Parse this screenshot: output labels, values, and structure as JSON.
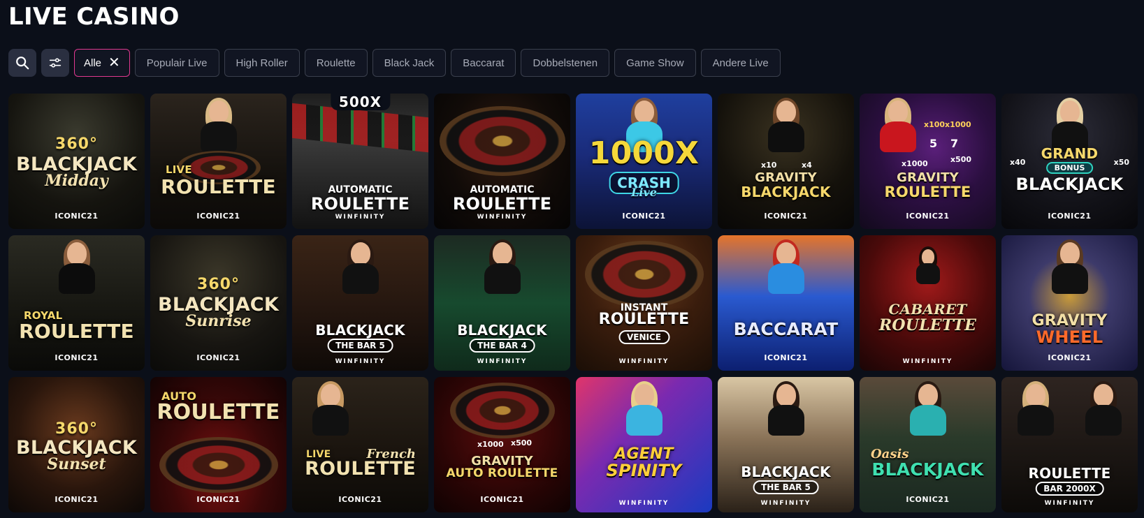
{
  "page": {
    "title": "LIVE CASINO"
  },
  "filters": {
    "search_icon": "search-icon",
    "filter_icon": "sliders-icon",
    "active_label": "Alle",
    "chips": [
      "Populair Live",
      "High Roller",
      "Roulette",
      "Black Jack",
      "Baccarat",
      "Dobbelstenen",
      "Game Show",
      "Andere Live"
    ]
  },
  "colors": {
    "background": "#0b0f19",
    "active_chip_border": "#e0388f",
    "chip_border": "#3a3f4d",
    "icon_button": "#2a2f40"
  },
  "games": [
    {
      "top": "360°",
      "main": "BLACKJACK",
      "sub": "Midday",
      "brand": "ICONIC21"
    },
    {
      "top": "LIVE",
      "main": "ROULETTE",
      "brand": "ICONIC21"
    },
    {
      "top": "500X",
      "small": "AUTOMATIC",
      "main": "ROULETTE",
      "brand": "WINFINITY"
    },
    {
      "small": "AUTOMATIC",
      "main": "ROULETTE",
      "brand": "WINFINITY"
    },
    {
      "main": "1000X",
      "sub": "CRASH",
      "sub2": "Live",
      "brand": "ICONIC21"
    },
    {
      "small": "GRAVITY",
      "main": "BLACKJACK",
      "brand": "ICONIC21",
      "m1": "x10",
      "m2": "x4"
    },
    {
      "small": "GRAVITY",
      "main": "ROULETTE",
      "brand": "ICONIC21",
      "m1": "x100",
      "m2": "x1000",
      "m3": "x1000",
      "m4": "x500",
      "n1": "5",
      "n2": "7"
    },
    {
      "small": "GRAND",
      "bonus": "BONUS",
      "main": "BLACKJACK",
      "brand": "ICONIC21",
      "m1": "x40",
      "m2": "x50"
    },
    {
      "small": "ROYAL",
      "main": "ROULETTE",
      "brand": "ICONIC21"
    },
    {
      "top": "360°",
      "main": "BLACKJACK",
      "sub": "Sunrise",
      "brand": "ICONIC21"
    },
    {
      "main": "BLACKJACK",
      "pill": "THE BAR 5",
      "brand": "WINFINITY"
    },
    {
      "main": "BLACKJACK",
      "pill": "THE BAR 4",
      "brand": "WINFINITY"
    },
    {
      "small": "INSTANT",
      "main": "ROULETTE",
      "pill": "VENICE",
      "brand": "WINFINITY"
    },
    {
      "main": "BACCARAT",
      "brand": "ICONIC21"
    },
    {
      "small": "CABARET",
      "main": "ROULETTE",
      "brand": "WINFINITY"
    },
    {
      "small": "GRAVITY",
      "main": "WHEEL",
      "brand": "ICONIC21"
    },
    {
      "top": "360°",
      "main": "BLACKJACK",
      "sub": "Sunset",
      "brand": "ICONIC21"
    },
    {
      "small": "AUTO",
      "main": "ROULETTE",
      "brand": "ICONIC21"
    },
    {
      "small": "LIVE",
      "sub": "French",
      "main": "ROULETTE",
      "brand": "ICONIC21"
    },
    {
      "small": "GRAVITY",
      "main": "AUTO ROULETTE",
      "brand": "ICONIC21",
      "m1": "x1000",
      "m2": "x500"
    },
    {
      "small": "AGENT",
      "main": "SPINITY",
      "brand": "WINFINITY"
    },
    {
      "main": "BLACKJACK",
      "pill": "THE BAR 5",
      "brand": "WINFINITY"
    },
    {
      "small": "Oasis",
      "main": "BLACKJACK",
      "brand": "ICONIC21"
    },
    {
      "main": "ROULETTE",
      "pill": "BAR 2000X",
      "brand": "WINFINITY"
    }
  ]
}
